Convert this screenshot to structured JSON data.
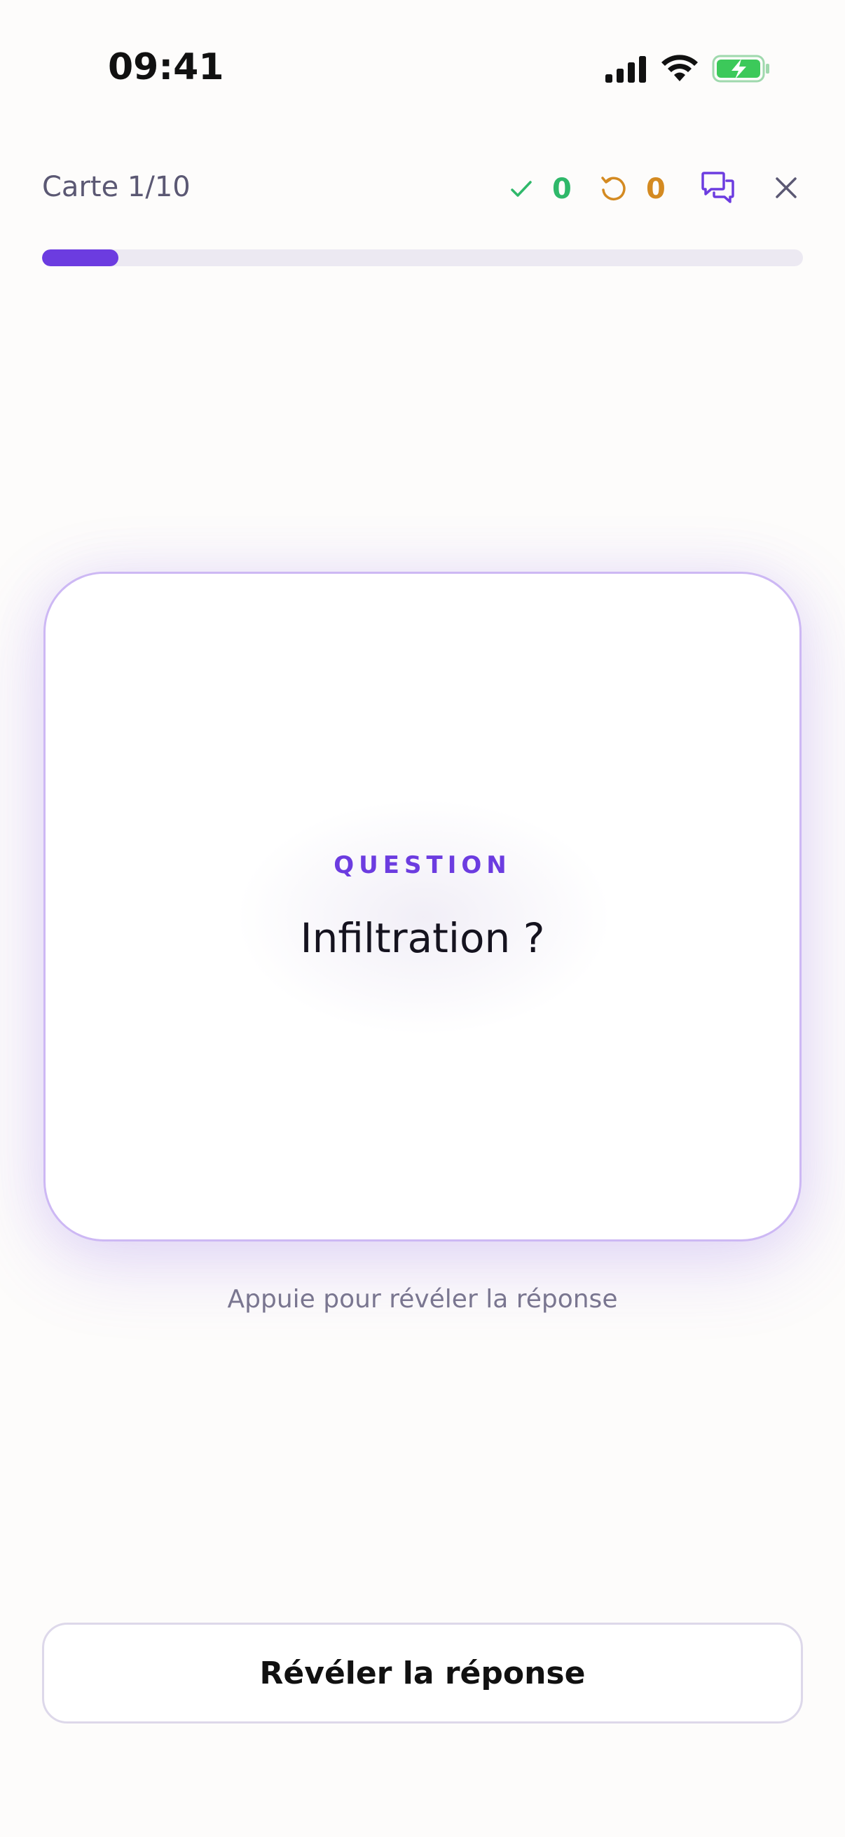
{
  "status_bar": {
    "time": "09:41",
    "icons": [
      "cellular-signal-icon",
      "wifi-icon",
      "battery-charging-icon"
    ]
  },
  "header": {
    "card_counter": "Carte 1/10",
    "known_count": "0",
    "review_count": "0",
    "icons": [
      "check-icon",
      "retry-icon",
      "chat-icon",
      "close-icon"
    ]
  },
  "progress": {
    "fraction": 0.1
  },
  "card": {
    "kicker": "QUESTION",
    "question": "Infiltration ?"
  },
  "hint": "Appuie pour révéler la réponse",
  "reveal_button": {
    "label": "Révéler la réponse"
  },
  "colors": {
    "accent": "#6c3ce0",
    "known": "#2fb86a",
    "review": "#d48a21",
    "battery": "#3cc95a"
  }
}
